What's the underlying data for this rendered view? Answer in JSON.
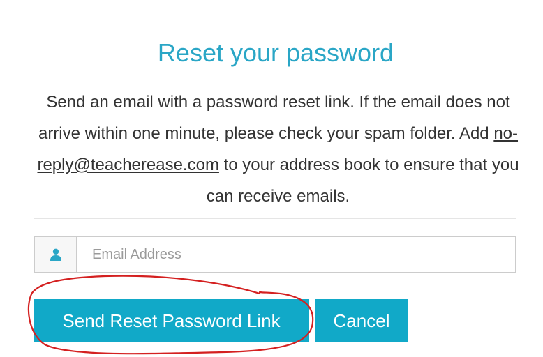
{
  "form": {
    "title": "Reset your password",
    "description_part1": "Send an email with a password reset link. If the email does not arrive within one minute, please check your spam folder. Add ",
    "description_email": "no-reply@teacherease.com",
    "description_part2": " to your address book to ensure that you can receive emails.",
    "email_placeholder": "Email Address",
    "email_value": "",
    "user_icon": "user-icon",
    "send_button_label": "Send Reset Password Link",
    "cancel_button_label": "Cancel"
  },
  "colors": {
    "title": "#2aa6c6",
    "button": "#11a9c8",
    "annotation_circle": "#d42020"
  }
}
